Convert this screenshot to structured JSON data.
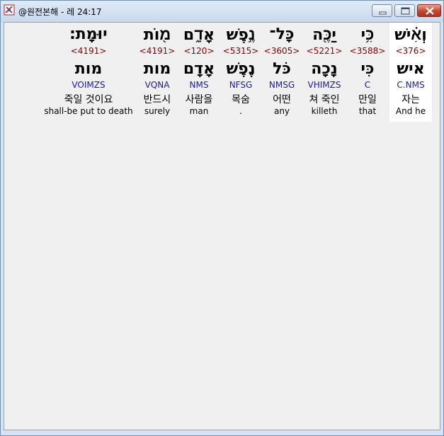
{
  "window": {
    "title": "@원전본해 - 레 24:17",
    "buttons": {
      "minimize": "minimize",
      "maximize": "maximize",
      "close": "close"
    }
  },
  "icons": {
    "app": "bible-app-icon",
    "minimize": "minimize-icon",
    "maximize": "maximize-icon",
    "close": "close-icon"
  },
  "colors": {
    "strong": "#8b0000",
    "morph": "#1a1aa6",
    "selected_bg": "#ffffff",
    "client_bg": "#f0f0f0"
  },
  "words": [
    {
      "hebrew_pointed": "וְאִ֗ישׁ",
      "strong": "<376>",
      "hebrew_plain": "איש",
      "morph": "C.NMS",
      "korean": "자는",
      "english": "And he"
    },
    {
      "hebrew_pointed": "כִּ֥י",
      "strong": "<3588>",
      "hebrew_plain": "כִּי",
      "morph": "C",
      "korean": "만일",
      "english": "that"
    },
    {
      "hebrew_pointed": "יַכֶּ֖ה",
      "strong": "<5221>",
      "hebrew_plain": "נָכָה",
      "morph": "VHIMZS",
      "korean": "쳐 죽인",
      "english": "killeth"
    },
    {
      "hebrew_pointed": "כָּל־",
      "strong": "<3605>",
      "hebrew_plain": "כֹּל",
      "morph": "NMSG",
      "korean": "어떤",
      "english": "any"
    },
    {
      "hebrew_pointed": "נֶ֣פֶשׁ",
      "strong": "<5315>",
      "hebrew_plain": "נֶפֶשׁ",
      "morph": "NFSG",
      "korean": "목숨",
      "english": "."
    },
    {
      "hebrew_pointed": "אָדָ֑ם",
      "strong": "<120>",
      "hebrew_plain": "אָדָם",
      "morph": "NMS",
      "korean": "사람을",
      "english": "man"
    },
    {
      "hebrew_pointed": "מ֖וֹת",
      "strong": "<4191>",
      "hebrew_plain": "מות",
      "morph": "VQNA",
      "korean": "반드시",
      "english": "surely"
    },
    {
      "hebrew_pointed": "יוּמָֽת׃",
      "strong": "<4191>",
      "hebrew_plain": "מות",
      "morph": "VOIMZS",
      "korean": "죽일 것이요",
      "english": "shall-be put to death"
    }
  ]
}
